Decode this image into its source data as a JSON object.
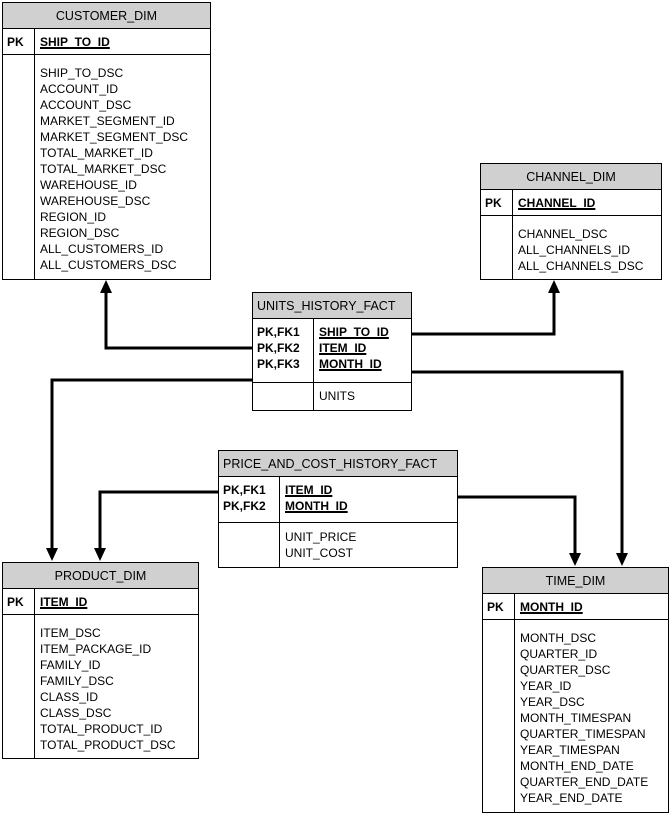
{
  "entities": {
    "customer_dim": {
      "title": "CUSTOMER_DIM",
      "key_labels": [
        "PK"
      ],
      "keys": [
        "SHIP_TO_ID"
      ],
      "attributes": [
        "SHIP_TO_DSC",
        "ACCOUNT_ID",
        "ACCOUNT_DSC",
        "MARKET_SEGMENT_ID",
        "MARKET_SEGMENT_DSC",
        "TOTAL_MARKET_ID",
        "TOTAL_MARKET_DSC",
        "WAREHOUSE_ID",
        "WAREHOUSE_DSC",
        "REGION_ID",
        "REGION_DSC",
        "ALL_CUSTOMERS_ID",
        "ALL_CUSTOMERS_DSC"
      ]
    },
    "channel_dim": {
      "title": "CHANNEL_DIM",
      "key_labels": [
        "PK"
      ],
      "keys": [
        "CHANNEL_ID"
      ],
      "attributes": [
        "CHANNEL_DSC",
        "ALL_CHANNELS_ID",
        "ALL_CHANNELS_DSC"
      ]
    },
    "units_history_fact": {
      "title": "UNITS_HISTORY_FACT",
      "key_labels": [
        "PK,FK1",
        "PK,FK2",
        "PK,FK3"
      ],
      "keys": [
        "SHIP_TO_ID",
        "ITEM_ID",
        "MONTH_ID"
      ],
      "attributes": [
        "UNITS"
      ]
    },
    "price_and_cost_history_fact": {
      "title": "PRICE_AND_COST_HISTORY_FACT",
      "key_labels": [
        "PK,FK1",
        "PK,FK2"
      ],
      "keys": [
        "ITEM_ID",
        "MONTH_ID"
      ],
      "attributes": [
        "UNIT_PRICE",
        "UNIT_COST"
      ]
    },
    "product_dim": {
      "title": "PRODUCT_DIM",
      "key_labels": [
        "PK"
      ],
      "keys": [
        "ITEM_ID"
      ],
      "attributes": [
        "ITEM_DSC",
        "ITEM_PACKAGE_ID",
        "FAMILY_ID",
        "FAMILY_DSC",
        "CLASS_ID",
        "CLASS_DSC",
        "TOTAL_PRODUCT_ID",
        "TOTAL_PRODUCT_DSC"
      ]
    },
    "time_dim": {
      "title": "TIME_DIM",
      "key_labels": [
        "PK"
      ],
      "keys": [
        "MONTH_ID"
      ],
      "attributes": [
        "MONTH_DSC",
        "QUARTER_ID",
        "QUARTER_DSC",
        "YEAR_ID",
        "YEAR_DSC",
        "MONTH_TIMESPAN",
        "QUARTER_TIMESPAN",
        "YEAR_TIMESPAN",
        "MONTH_END_DATE",
        "QUARTER_END_DATE",
        "YEAR_END_DATE"
      ]
    }
  },
  "relationships": [
    {
      "from": "UNITS_HISTORY_FACT",
      "to": "CUSTOMER_DIM",
      "key": "SHIP_TO_ID"
    },
    {
      "from": "UNITS_HISTORY_FACT",
      "to": "CHANNEL_DIM",
      "key": "SHIP_TO_ID"
    },
    {
      "from": "UNITS_HISTORY_FACT",
      "to": "PRODUCT_DIM",
      "key": "ITEM_ID"
    },
    {
      "from": "UNITS_HISTORY_FACT",
      "to": "TIME_DIM",
      "key": "MONTH_ID"
    },
    {
      "from": "PRICE_AND_COST_HISTORY_FACT",
      "to": "PRODUCT_DIM",
      "key": "ITEM_ID"
    },
    {
      "from": "PRICE_AND_COST_HISTORY_FACT",
      "to": "TIME_DIM",
      "key": "MONTH_ID"
    }
  ],
  "colors": {
    "header_fill": "#d0d0d0",
    "line": "#000000"
  }
}
